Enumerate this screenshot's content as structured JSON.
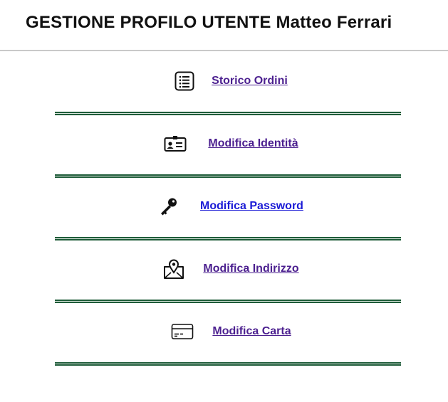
{
  "header": {
    "title": "GESTIONE PROFILO UTENTE Matteo Ferrari"
  },
  "menu": {
    "items": [
      {
        "label": "Storico Ordini",
        "icon": "list-icon"
      },
      {
        "label": "Modifica Identità",
        "icon": "id-card-icon"
      },
      {
        "label": "Modifica Password",
        "icon": "key-icon"
      },
      {
        "label": "Modifica Indirizzo",
        "icon": "map-pin-icon"
      },
      {
        "label": "Modifica Carta",
        "icon": "credit-card-icon"
      }
    ]
  },
  "colors": {
    "link": "#4b1f8f",
    "link_active": "#1a1ad6",
    "divider": "#1f5c3a"
  }
}
